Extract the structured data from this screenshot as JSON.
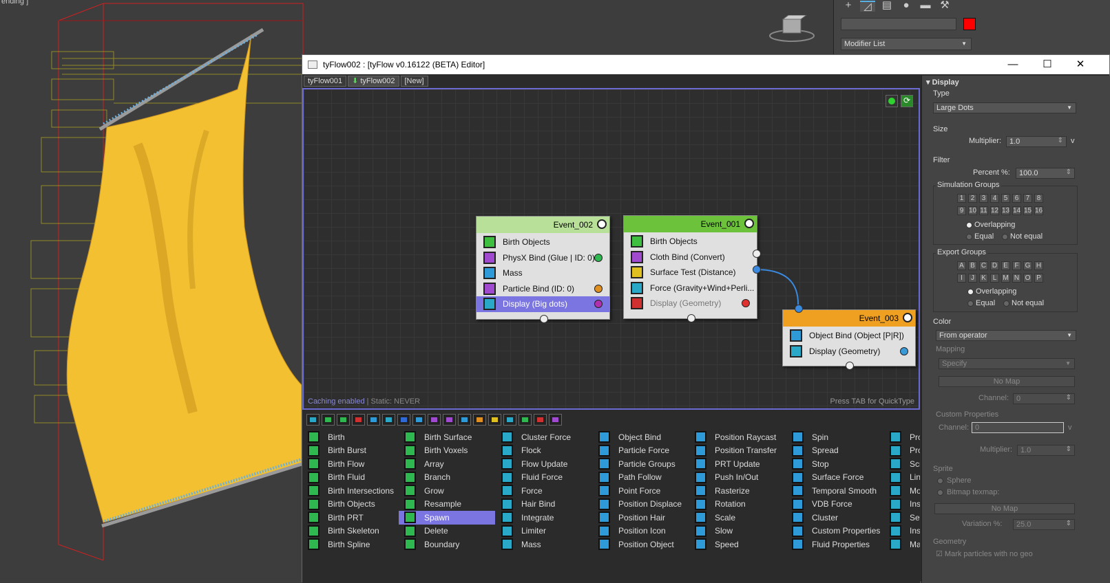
{
  "viewport": {
    "label": "ending ]"
  },
  "command_panel": {
    "modifier_list": "Modifier List",
    "color": "#ff0000"
  },
  "editor": {
    "title": "tyFlow002 : [tyFlow v0.16122 (BETA) Editor]",
    "tabs": [
      "tyFlow001",
      "tyFlow002",
      "[New]"
    ],
    "status": {
      "caching": "Caching enabled",
      "static": " | Static: NEVER"
    },
    "quicktype_hint": "Press TAB for QuickType",
    "events": [
      {
        "name": "Event_002",
        "header_color": "#b8e098",
        "operators": [
          {
            "label": "Birth Objects",
            "icon_color": "#3fbf3f"
          },
          {
            "label": "PhysX Bind (Glue | ID: 0)",
            "icon_color": "#a04ad0",
            "dot": "#2fb84f"
          },
          {
            "label": "Mass",
            "icon_color": "#2f9ad8"
          },
          {
            "label": "Particle Bind (ID: 0)",
            "icon_color": "#a04ad0",
            "dot": "#e09020"
          },
          {
            "label": "Display (Big dots)",
            "icon_color": "#29a8c8",
            "dot": "#b030b0",
            "selected": true
          }
        ]
      },
      {
        "name": "Event_001",
        "header_color": "#6cc23a",
        "operators": [
          {
            "label": "Birth Objects",
            "icon_color": "#3fbf3f"
          },
          {
            "label": "Cloth Bind (Convert)",
            "icon_color": "#a04ad0"
          },
          {
            "label": "Surface Test (Distance)",
            "icon_color": "#e0c020"
          },
          {
            "label": "Force (Gravity+Wind+Perli...",
            "icon_color": "#29a8c8"
          },
          {
            "label": "Display (Geometry)",
            "icon_color": "#d03030",
            "dot": "#e03030",
            "disabled": true
          }
        ]
      },
      {
        "name": "Event_003",
        "header_color": "#f0a020",
        "operators": [
          {
            "label": "Object Bind (Object [P|R])",
            "icon_color": "#2f9ad8"
          },
          {
            "label": "Display (Geometry)",
            "icon_color": "#29a8c8",
            "dot": "#3a9ad8"
          }
        ]
      }
    ],
    "palette_columns": [
      {
        "color": "#2fb84f",
        "items": [
          "Birth",
          "Birth Burst",
          "Birth Flow",
          "Birth Fluid",
          "Birth Intersections",
          "Birth Objects",
          "Birth PRT",
          "Birth Skeleton",
          "Birth Spline"
        ]
      },
      {
        "color": "#2fb84f",
        "items": [
          "Birth Surface",
          "Birth Voxels",
          "Array",
          "Branch",
          "Grow",
          "Resample",
          "Spawn",
          "Delete",
          "Boundary"
        ],
        "selected": "Spawn"
      },
      {
        "color": "#29a8c8",
        "items": [
          "Cluster Force",
          "Flock",
          "Flow Update",
          "Fluid Force",
          "Force",
          "Hair Bind",
          "Integrate",
          "Limiter",
          "Mass"
        ]
      },
      {
        "color": "#2f9ad8",
        "items": [
          "Object Bind",
          "Particle Force",
          "Particle Groups",
          "Path Follow",
          "Point Force",
          "Position Displace",
          "Position Hair",
          "Position Icon",
          "Position Object"
        ]
      },
      {
        "color": "#2f9ad8",
        "items": [
          "Position Raycast",
          "Position Transfer",
          "PRT Update",
          "Push In/Out",
          "Rasterize",
          "Rotation",
          "Scale",
          "Slow",
          "Speed"
        ]
      },
      {
        "color": "#2f9ad8",
        "items": [
          "Spin",
          "Spread",
          "Stop",
          "Surface Force",
          "Temporal Smooth",
          "VDB Force",
          "Cluster",
          "Custom Properties",
          "Fluid Properties"
        ]
      },
      {
        "color": "#29a8c8",
        "items": [
          "Pro",
          "Pro",
          "Scr",
          "Lin",
          "Mo",
          "Ins",
          "Set",
          "Ins",
          "Ma"
        ]
      }
    ],
    "palette_icons": [
      "#29a8c8",
      "#2fb84f",
      "#2fb84f",
      "#d03030",
      "#2f9ad8",
      "#29a8c8",
      "#2f6ad8",
      "#2f9ad8",
      "#a04ad0",
      "#a04ad0",
      "#2f9ad8",
      "#e09020",
      "#e0c020",
      "#29a8c8",
      "#2fb84f",
      "#d03030",
      "#a04ad0"
    ]
  },
  "props": {
    "display_title": "Display",
    "type_label": "Type",
    "type_value": "Large Dots",
    "size_label": "Size",
    "multiplier_label": "Multiplier:",
    "multiplier_value": "1.0",
    "filter_label": "Filter",
    "percent_label": "Percent %:",
    "percent_value": "100.0",
    "sim_groups_label": "Simulation Groups",
    "sim_groups": [
      "1",
      "2",
      "3",
      "4",
      "5",
      "6",
      "7",
      "8",
      "9",
      "10",
      "11",
      "12",
      "13",
      "14",
      "15",
      "16"
    ],
    "overlapping": "Overlapping",
    "equal": "Equal",
    "not_equal": "Not equal",
    "export_groups_label": "Export Groups",
    "export_groups": [
      "A",
      "B",
      "C",
      "D",
      "E",
      "F",
      "G",
      "H",
      "I",
      "J",
      "K",
      "L",
      "M",
      "N",
      "O",
      "P"
    ],
    "color_label": "Color",
    "color_value": "From operator",
    "mapping_label": "Mapping",
    "mapping_value": "Specify",
    "no_map": "No Map",
    "channel_label": "Channel:",
    "channel_value": "0",
    "custom_props_label": "Custom Properties",
    "custom_channel_value": "0",
    "multiplier2_value": "1.0",
    "sprite_label": "Sprite",
    "sphere": "Sphere",
    "bitmap": "Bitmap texmap:",
    "no_map2": "No Map",
    "variation_label": "Variation %:",
    "variation_value": "25.0",
    "geometry_label": "Geometry",
    "mark_particles": "Mark particles with no geo"
  }
}
